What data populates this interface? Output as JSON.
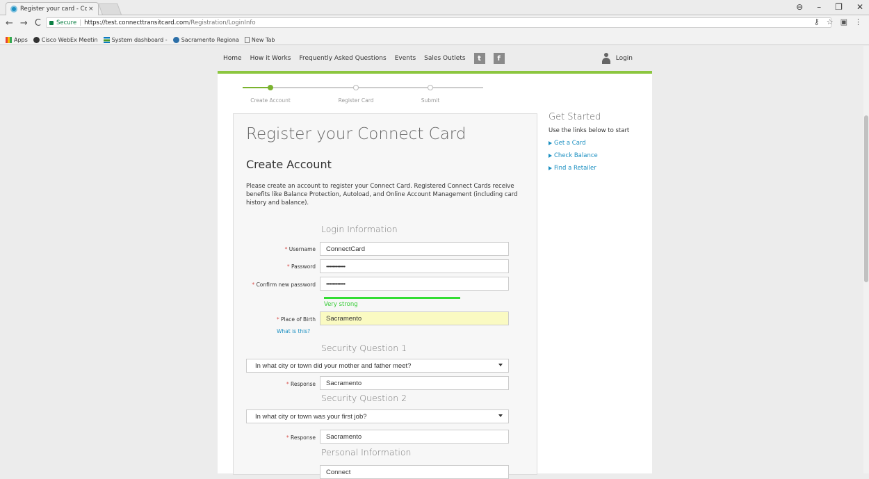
{
  "browser": {
    "tab_title": "Register your card - Conn",
    "tab_close": "×",
    "url_secure": "Secure",
    "url_host": "https://test.connecttransitcard.com",
    "url_path": "/Registration/LoginInfo",
    "bookmarks": [
      "Apps",
      "Cisco WebEx Meetin",
      "System dashboard -",
      "Sacramento Regiona",
      "New Tab"
    ]
  },
  "topnav": {
    "items": [
      "Home",
      "How it Works",
      "Frequently Asked Questions",
      "Events",
      "Sales Outlets"
    ],
    "twitter": "t",
    "facebook": "f",
    "login": "Login"
  },
  "progress": {
    "steps": [
      "Create Account",
      "Register Card",
      "Submit"
    ],
    "current_step": 1,
    "active_color": "#7ab32e"
  },
  "form": {
    "title": "Register your Connect Card",
    "subtitle": "Create Account",
    "intro": "Please create an account to register your Connect Card. Registered Connect Cards receive benefits like Balance Protection, Autoload, and Online Account Management (including card history and balance).",
    "login_section": "Login Information",
    "username_label": "Username",
    "username_value": "ConnectCard",
    "password_label": "Password",
    "password_value": "•••••••••••••••",
    "confirm_label": "Confirm new password",
    "confirm_value": "•••••••••••••••",
    "strength_text": "Very strong",
    "place_label": "Place of Birth",
    "place_value": "Sacramento",
    "what_is_this": "What is this?",
    "sq1_section": "Security Question 1",
    "sq1_question": "In what city or town did your mother and father meet?",
    "response_label": "Response",
    "sq1_response": "Sacramento",
    "sq2_section": "Security Question 2",
    "sq2_question": "In what city or town was your first job?",
    "sq2_response": "Sacramento",
    "personal_section": "Personal Information",
    "first_name_value": "Connect",
    "required_mark": "*"
  },
  "sidebar": {
    "title": "Get Started",
    "sub": "Use the links below to start",
    "links": [
      "Get a Card",
      "Check Balance",
      "Find a Retailer"
    ]
  }
}
